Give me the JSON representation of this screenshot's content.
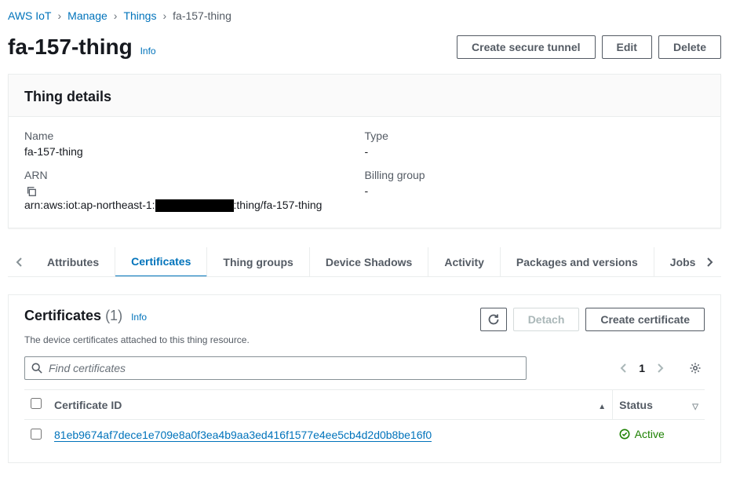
{
  "breadcrumb": {
    "root": "AWS IoT",
    "l1": "Manage",
    "l2": "Things",
    "current": "fa-157-thing"
  },
  "header": {
    "title": "fa-157-thing",
    "info": "Info",
    "actions": {
      "tunnel": "Create secure tunnel",
      "edit": "Edit",
      "delete": "Delete"
    }
  },
  "details": {
    "panel_title": "Thing details",
    "name_label": "Name",
    "name_value": "fa-157-thing",
    "arn_label": "ARN",
    "arn_prefix": "arn:aws:iot:ap-northeast-1:",
    "arn_suffix": ":thing/fa-157-thing",
    "type_label": "Type",
    "type_value": "-",
    "billing_label": "Billing group",
    "billing_value": "-"
  },
  "tabs": {
    "items": [
      "Attributes",
      "Certificates",
      "Thing groups",
      "Device Shadows",
      "Activity",
      "Packages and versions",
      "Jobs"
    ]
  },
  "certs": {
    "title": "Certificates",
    "count": "(1)",
    "info": "Info",
    "desc": "The device certificates attached to this thing resource.",
    "actions": {
      "detach": "Detach",
      "create": "Create certificate"
    },
    "search_placeholder": "Find certificates",
    "page": "1",
    "columns": {
      "id": "Certificate ID",
      "status": "Status"
    },
    "rows": [
      {
        "id": "81eb9674af7dece1e709e8a0f3ea4b9aa3ed416f1577e4ee5cb4d2d0b8be16f0",
        "status": "Active"
      }
    ]
  }
}
